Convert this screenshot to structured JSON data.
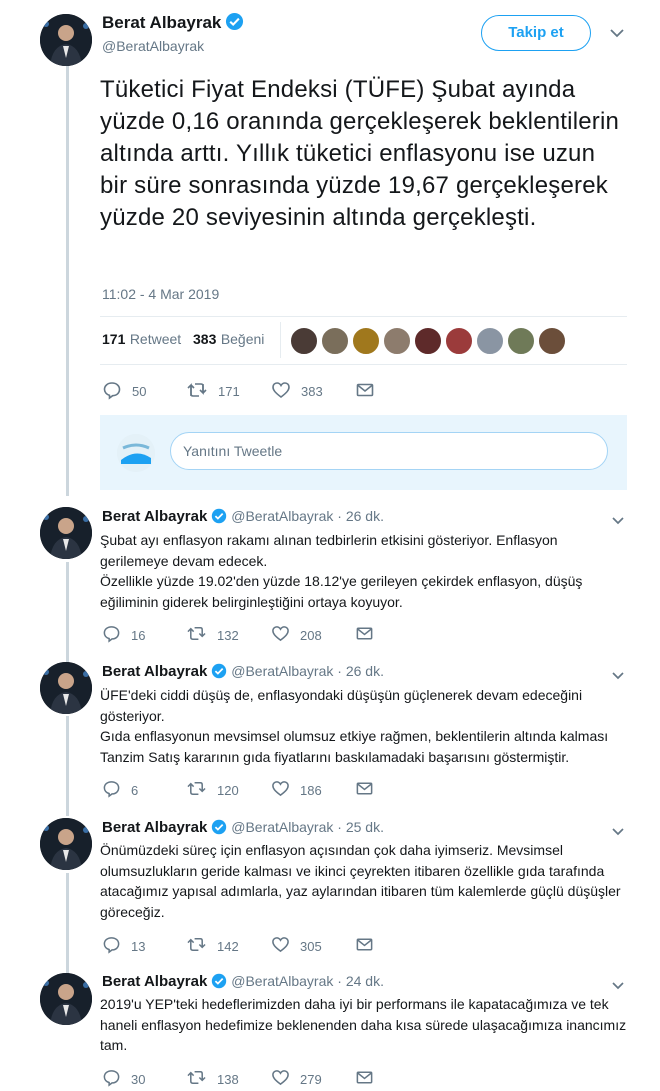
{
  "main": {
    "author_name": "Berat Albayrak",
    "handle": "@BeratAlbayrak",
    "follow_label": "Takip et",
    "text": "Tüketici Fiyat Endeksi (TÜFE) Şubat ayında yüzde 0,16 oranında gerçekleşerek beklentilerin altında arttı. Yıllık tüketici enflasyonu ise uzun bir süre sonrasında yüzde 19,67 gerçekleşerek yüzde 20 seviyesinin altında gerçekleşti.",
    "timestamp": "11:02 - 4 Mar 2019",
    "retweets": "171",
    "retweets_label": "Retweet",
    "likes": "383",
    "likes_label": "Beğeni",
    "actions": {
      "replies": "50",
      "retweets": "171",
      "likes": "383"
    }
  },
  "reply_box": {
    "placeholder": "Yanıtını Tweetle"
  },
  "replies": [
    {
      "name": "Berat Albayrak",
      "handle": "@BeratAlbayrak",
      "time": "· 26 dk.",
      "lines": [
        "Şubat ayı enflasyon rakamı alınan tedbirlerin etkisini gösteriyor. Enflasyon gerilemeye devam edecek.",
        "Özellikle yüzde 19.02'den yüzde 18.12'ye gerileyen çekirdek enflasyon, düşüş eğiliminin giderek belirginleştiğini ortaya koyuyor."
      ],
      "replies": "16",
      "retweets": "132",
      "likes": "208"
    },
    {
      "name": "Berat Albayrak",
      "handle": "@BeratAlbayrak",
      "time": "· 26 dk.",
      "lines": [
        "ÜFE'deki ciddi düşüş de, enflasyondaki düşüşün güçlenerek devam edeceğini gösteriyor.",
        "Gıda enflasyonun mevsimsel olumsuz etkiye rağmen, beklentilerin altında kalması Tanzim Satış kararının gıda fiyatlarını baskılamadaki başarısını göstermiştir."
      ],
      "replies": "6",
      "retweets": "120",
      "likes": "186"
    },
    {
      "name": "Berat Albayrak",
      "handle": "@BeratAlbayrak",
      "time": "· 25 dk.",
      "lines": [
        "Önümüzdeki süreç için enflasyon açısından çok daha iyimseriz. Mevsimsel olumsuzlukların geride kalması ve ikinci çeyrekten itibaren özellikle gıda tarafında atacağımız yapısal adımlarla, yaz aylarından itibaren tüm kalemlerde güçlü düşüşler göreceğiz."
      ],
      "replies": "13",
      "retweets": "142",
      "likes": "305"
    },
    {
      "name": "Berat Albayrak",
      "handle": "@BeratAlbayrak",
      "time": "· 24 dk.",
      "lines": [
        "2019'u YEP'teki hedeflerimizden daha iyi bir performans ile kapatacağımıza ve tek haneli enflasyon hedefimize beklenenden daha kısa sürede ulaşacağımıza inancımız tam."
      ],
      "replies": "30",
      "retweets": "138",
      "likes": "279"
    }
  ],
  "icons": {
    "reply": "reply-icon",
    "retweet": "retweet-icon",
    "like": "heart-icon",
    "dm": "envelope-icon",
    "verified": "verified-badge-icon",
    "more": "chevron-down-icon"
  },
  "colors": {
    "accent": "#1da1f2",
    "muted": "#657786",
    "reply_box_bg": "#e8f5fd"
  }
}
